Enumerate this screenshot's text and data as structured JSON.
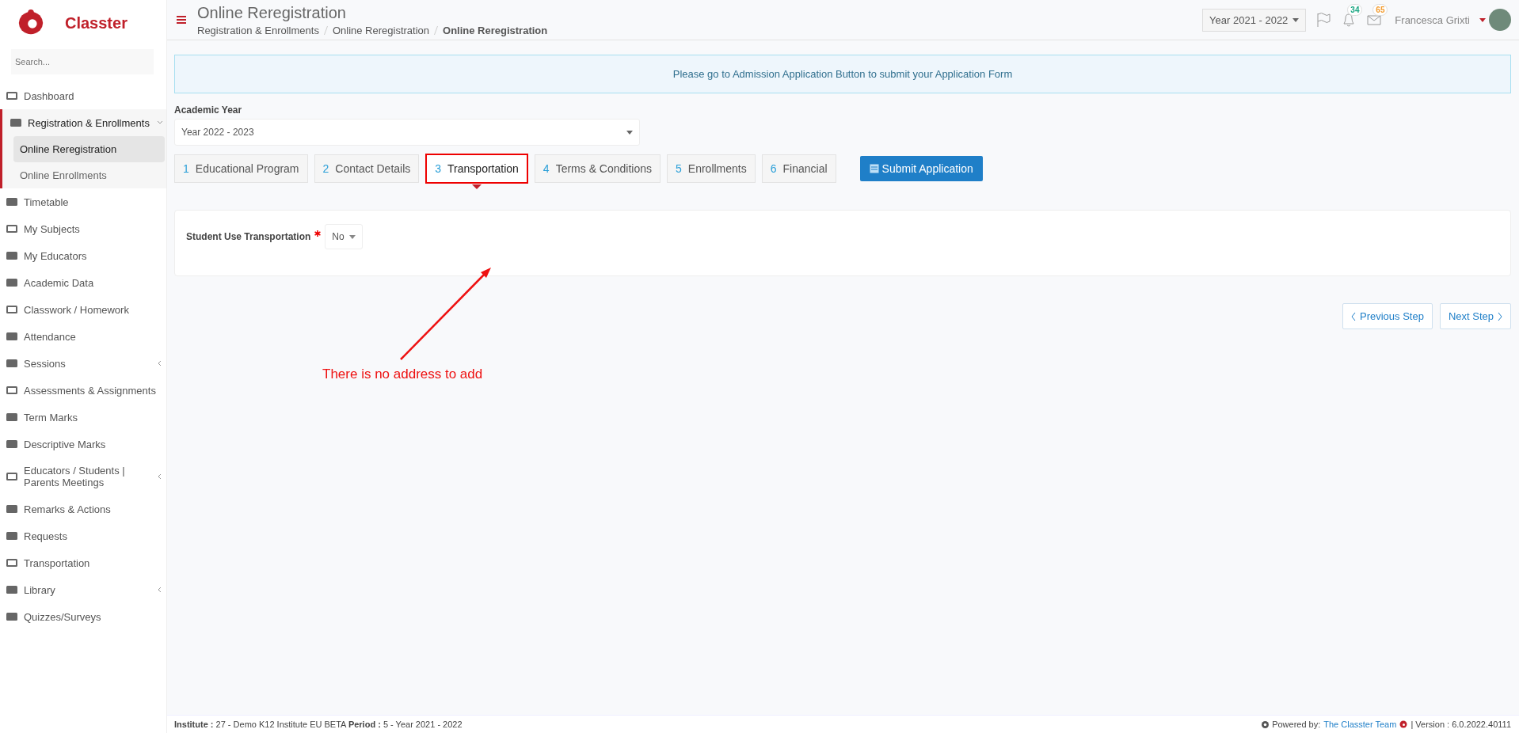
{
  "brand": {
    "name": "Classter"
  },
  "sidebar": {
    "search": {
      "placeholder": "Search..."
    },
    "items": [
      {
        "label": "Dashboard",
        "expandable": false,
        "expanded": false
      },
      {
        "label": "Registration & Enrollments",
        "expandable": true,
        "expanded": true,
        "children": [
          {
            "label": "Online Reregistration",
            "selected": true
          },
          {
            "label": "Online Enrollments",
            "selected": false
          }
        ]
      },
      {
        "label": "Timetable",
        "expandable": false,
        "expanded": false
      },
      {
        "label": "My Subjects",
        "expandable": false,
        "expanded": false
      },
      {
        "label": "My Educators",
        "expandable": false,
        "expanded": false
      },
      {
        "label": "Academic Data",
        "expandable": false,
        "expanded": false
      },
      {
        "label": "Classwork / Homework",
        "expandable": false,
        "expanded": false
      },
      {
        "label": "Attendance",
        "expandable": false,
        "expanded": false
      },
      {
        "label": "Sessions",
        "expandable": true,
        "expanded": false
      },
      {
        "label": "Assessments & Assignments",
        "expandable": false,
        "expanded": false
      },
      {
        "label": "Term Marks",
        "expandable": false,
        "expanded": false
      },
      {
        "label": "Descriptive Marks",
        "expandable": false,
        "expanded": false
      },
      {
        "label": "Educators / Students | Parents Meetings",
        "expandable": true,
        "expanded": false
      },
      {
        "label": "Remarks & Actions",
        "expandable": false,
        "expanded": false
      },
      {
        "label": "Requests",
        "expandable": false,
        "expanded": false
      },
      {
        "label": "Transportation",
        "expandable": false,
        "expanded": false
      },
      {
        "label": "Library",
        "expandable": true,
        "expanded": false
      },
      {
        "label": "Quizzes/Surveys",
        "expandable": false,
        "expanded": false
      }
    ]
  },
  "header": {
    "title": "Online Reregistration",
    "breadcrumb": [
      "Registration & Enrollments",
      "Online Reregistration",
      "Online Reregistration"
    ],
    "year_selector": "Year 2021 - 2022",
    "notifications_badge": "34",
    "messages_badge": "65",
    "user_name": "Francesca Grixti"
  },
  "alert": "Please go to Admission Application Button to submit your Application Form",
  "academic_year": {
    "label": "Academic Year",
    "value": "Year 2022 - 2023"
  },
  "steps": [
    {
      "number": "1",
      "label": "Educational Program",
      "selected": false
    },
    {
      "number": "2",
      "label": "Contact Details",
      "selected": false
    },
    {
      "number": "3",
      "label": "Transportation",
      "selected": true
    },
    {
      "number": "4",
      "label": "Terms & Conditions",
      "selected": false
    },
    {
      "number": "5",
      "label": "Enrollments",
      "selected": false
    },
    {
      "number": "6",
      "label": "Financial",
      "selected": false
    }
  ],
  "submit_button": "Submit Application",
  "form": {
    "label": "Student Use Transportation",
    "required": true,
    "value": "No"
  },
  "nav_buttons": {
    "previous": "Previous Step",
    "next": "Next Step"
  },
  "annotation": "There is no address to add",
  "footer": {
    "info": "**Institute :** 27 - Demo K12 Institute EU BETA **Period :** 5 - Year 2021 - 2022",
    "powered_by": "Powered by:",
    "team_link": "The Classter Team",
    "version": "| Version : 6.0.2022.40111"
  }
}
